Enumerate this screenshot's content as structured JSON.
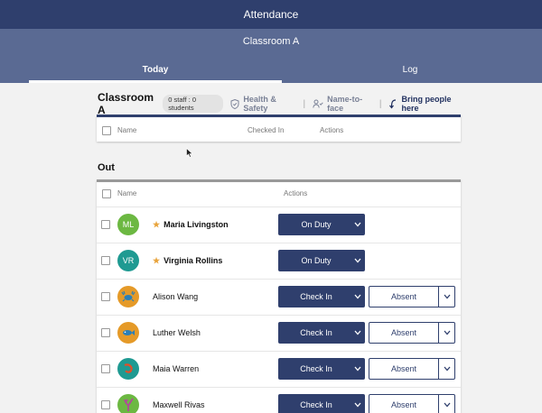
{
  "topbar": {
    "title": "Attendance"
  },
  "subbar": {
    "room": "Classroom A",
    "tabs": [
      {
        "label": "Today"
      },
      {
        "label": "Log"
      }
    ]
  },
  "section": {
    "title": "Classroom A",
    "count": "0 staff : 0 students",
    "health_safety": "Health & Safety",
    "separator": "|",
    "name_to_face": "Name-to-face",
    "bring_people": "Bring people here"
  },
  "table_in": {
    "headers": {
      "name": "Name",
      "checked_in": "Checked In",
      "actions": "Actions"
    }
  },
  "out": {
    "title": "Out",
    "headers": {
      "name": "Name",
      "actions": "Actions"
    },
    "rows": [
      {
        "initials": "ML",
        "name": "Maria Livingston",
        "star": true,
        "action": "On Duty",
        "secondary": "",
        "avatar_color": "#6cb842",
        "avatar_icon": ""
      },
      {
        "initials": "VR",
        "name": "Virginia Rollins",
        "star": true,
        "action": "On Duty",
        "secondary": "",
        "avatar_color": "#1f9a92",
        "avatar_icon": ""
      },
      {
        "initials": "",
        "name": "Alison Wang",
        "star": false,
        "action": "Check In",
        "secondary": "Absent",
        "avatar_color": "#e59a28",
        "avatar_icon": "crab-icon"
      },
      {
        "initials": "",
        "name": "Luther Welsh",
        "star": false,
        "action": "Check In",
        "secondary": "Absent",
        "avatar_color": "#e59a28",
        "avatar_icon": "fish-icon"
      },
      {
        "initials": "",
        "name": "Maia Warren",
        "star": false,
        "action": "Check In",
        "secondary": "Absent",
        "avatar_color": "#1f9a92",
        "avatar_icon": "shrimp-icon"
      },
      {
        "initials": "",
        "name": "Maxwell Rivas",
        "star": false,
        "action": "Check In",
        "secondary": "Absent",
        "avatar_color": "#6cb842",
        "avatar_icon": "coral-icon"
      }
    ]
  },
  "colors": {
    "primary": "#2f3f6d",
    "secondary_bar": "#5a6a93",
    "star": "#e8a33a"
  }
}
